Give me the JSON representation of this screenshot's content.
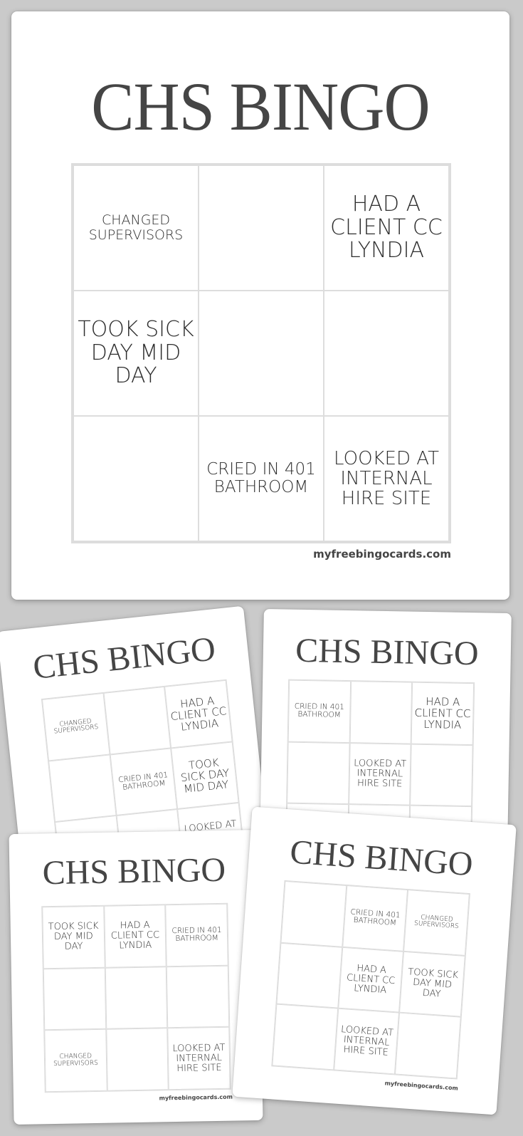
{
  "page": {
    "background": "#cacaca"
  },
  "watermark": "myfreebingocards.com",
  "main_card": {
    "title": "CHS BINGO",
    "cells": [
      "CHANGED SUPERVISORS",
      "",
      "HAD A CLIENT CC LYNDIA",
      "TOOK SICK DAY MID DAY",
      "",
      "",
      "",
      "CRIED IN 401 BATHROOM",
      "LOOKED AT INTERNAL HIRE SITE"
    ]
  },
  "preview_cards": [
    {
      "title": "CHS BINGO",
      "cells": [
        "CHANGED SUPERVISORS",
        "",
        "HAD A CLIENT CC LYNDIA",
        "",
        "CRIED IN 401 BATHROOM",
        "TOOK SICK DAY MID DAY",
        "",
        "",
        "LOOKED AT INTERNAL HIRE SITE"
      ]
    },
    {
      "title": "CHS BINGO",
      "cells": [
        "CRIED IN 401 BATHROOM",
        "",
        "HAD A CLIENT CC LYNDIA",
        "",
        "LOOKED AT INTERNAL HIRE SITE",
        "",
        "",
        "",
        ""
      ]
    },
    {
      "title": "CHS BINGO",
      "cells": [
        "TOOK SICK DAY MID DAY",
        "HAD A CLIENT CC LYNDIA",
        "CRIED IN 401 BATHROOM",
        "",
        "",
        "",
        "CHANGED SUPERVISORS",
        "",
        "LOOKED AT INTERNAL HIRE SITE"
      ]
    },
    {
      "title": "CHS BINGO",
      "cells": [
        "",
        "CRIED IN 401 BATHROOM",
        "CHANGED SUPERVISORS",
        "",
        "HAD A CLIENT CC LYNDIA",
        "TOOK SICK DAY MID DAY",
        "",
        "LOOKED AT INTERNAL HIRE SITE",
        ""
      ]
    }
  ]
}
